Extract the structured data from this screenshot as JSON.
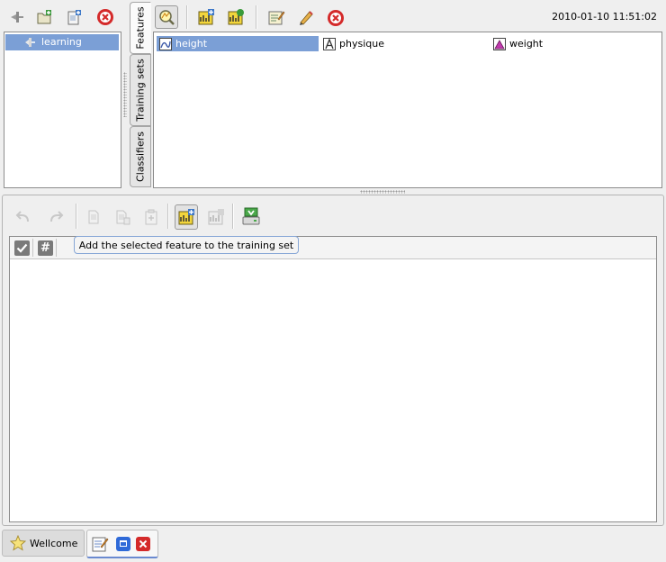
{
  "left_toolbar": {
    "icons": [
      "connect-icon",
      "open-folder-icon",
      "new-document-icon",
      "close-circle-icon"
    ]
  },
  "tree": {
    "items": [
      {
        "label": "learning",
        "icon": "plug-icon",
        "selected": true
      }
    ]
  },
  "tabs": [
    {
      "label": "Features",
      "active": true
    },
    {
      "label": "Training sets",
      "active": false
    },
    {
      "label": "Classifiers",
      "active": false
    }
  ],
  "top_toolbar": {
    "timestamp": "2010-01-10 11:51:02",
    "icons": [
      "inspect-feature-icon",
      "add-feature-icon",
      "feature-settings-icon",
      "edit-icon",
      "pencil-icon",
      "close-circle-icon"
    ]
  },
  "features": [
    {
      "label": "height",
      "selected": true,
      "icon": "numeric-feature-icon"
    },
    {
      "label": "physique",
      "selected": false,
      "icon": "text-feature-icon"
    },
    {
      "label": "weight",
      "selected": false,
      "icon": "nominal-feature-icon"
    }
  ],
  "bottom_toolbar": {
    "icons": [
      "undo-icon",
      "redo-icon",
      "copy-icon",
      "paste-icon",
      "clipboard-icon",
      "add-feature-to-training-set-icon",
      "remove-feature-icon",
      "save-icon"
    ]
  },
  "table": {
    "columns": [
      {
        "icon": "checkbox-column-icon"
      },
      {
        "label": "#",
        "icon": "hash-column-icon"
      }
    ]
  },
  "tooltip": {
    "text": "Add the selected feature to the training set"
  },
  "taskbar": {
    "wellcome_label": "Wellcome",
    "icons": [
      "star-icon",
      "notepad-icon",
      "maximize-icon",
      "close-icon"
    ]
  },
  "colors": {
    "selection": "#7b9fd6",
    "close_red": "#d42a2a"
  }
}
